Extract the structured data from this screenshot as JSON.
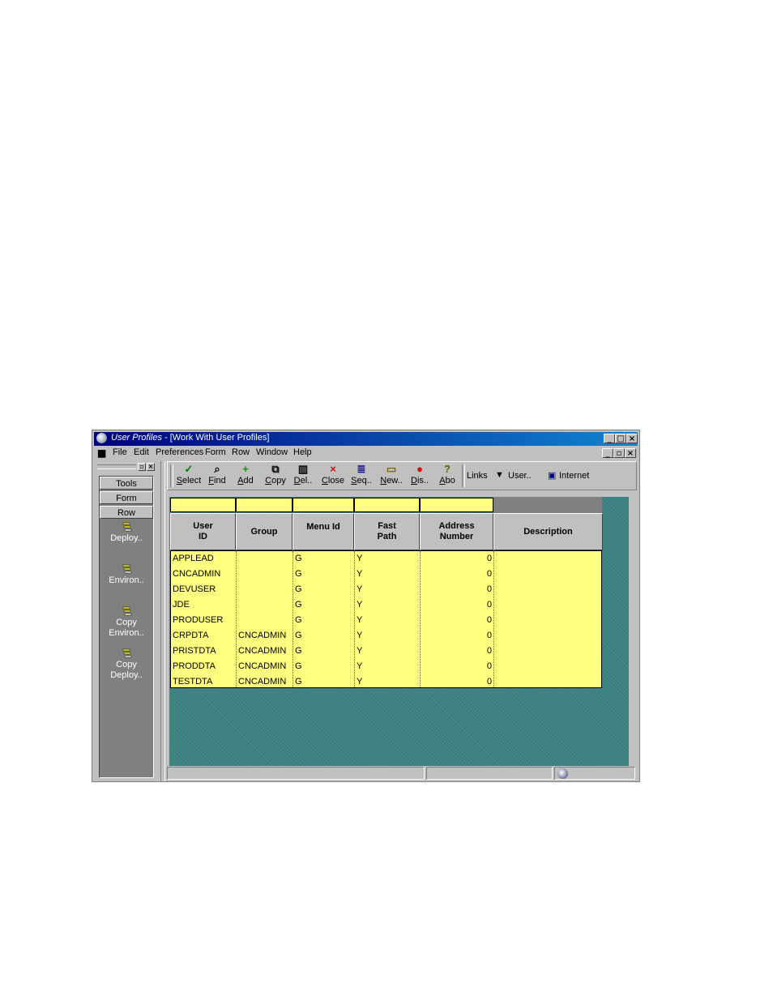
{
  "window": {
    "app_title": "User Profiles",
    "form_title": " - [Work With User Profiles]"
  },
  "menu": [
    "File",
    "Edit",
    "Preferences",
    "Form",
    "Row",
    "Window",
    "Help"
  ],
  "sidebar": {
    "tabs": [
      "Tools",
      "Form",
      "Row"
    ],
    "items": [
      {
        "line1": "Deploy..",
        "line2": ""
      },
      {
        "line1": "Environ..",
        "line2": ""
      },
      {
        "line1": "Copy",
        "line2": "Environ.."
      },
      {
        "line1": "Copy",
        "line2": "Deploy.."
      }
    ]
  },
  "toolbar": {
    "buttons": [
      {
        "label": "Select",
        "icon": "check-icon"
      },
      {
        "label": "Find",
        "icon": "find-icon"
      },
      {
        "label": "Add",
        "icon": "plus-icon"
      },
      {
        "label": "Copy",
        "icon": "copy-icon"
      },
      {
        "label": "Del..",
        "icon": "trash-icon"
      },
      {
        "label": "Close",
        "icon": "x-icon"
      },
      {
        "label": "Seq..",
        "icon": "sequence-icon"
      },
      {
        "label": "New..",
        "icon": "new-icon"
      },
      {
        "label": "Dis..",
        "icon": "display-icon"
      },
      {
        "label": "Abo",
        "icon": "about-icon"
      }
    ],
    "links_label": "Links",
    "user_label": "User..",
    "internet_label": "Internet"
  },
  "grid": {
    "columns": [
      {
        "line1": "User",
        "line2": "ID"
      },
      {
        "line1": "Group",
        "line2": ""
      },
      {
        "line1": "Menu Id",
        "line2": ""
      },
      {
        "line1": "Fast",
        "line2": "Path"
      },
      {
        "line1": "Address",
        "line2": "Number"
      },
      {
        "line1": "Description",
        "line2": ""
      }
    ],
    "rows": [
      [
        "APPLEAD",
        "",
        "G",
        "Y",
        "0",
        ""
      ],
      [
        "CNCADMIN",
        "",
        "G",
        "Y",
        "0",
        ""
      ],
      [
        "DEVUSER",
        "",
        "G",
        "Y",
        "0",
        ""
      ],
      [
        "JDE",
        "",
        "G",
        "Y",
        "0",
        ""
      ],
      [
        "PRODUSER",
        "",
        "G",
        "Y",
        "0",
        ""
      ],
      [
        "CRPDTA",
        "CNCADMIN",
        "G",
        "Y",
        "0",
        ""
      ],
      [
        "PRISTDTA",
        "CNCADMIN",
        "G",
        "Y",
        "0",
        ""
      ],
      [
        "PRODDTA",
        "CNCADMIN",
        "G",
        "Y",
        "0",
        ""
      ],
      [
        "TESTDTA",
        "CNCADMIN",
        "G",
        "Y",
        "0",
        ""
      ]
    ]
  },
  "colors": {
    "grid_background": "#3a7f7f",
    "row_fill": "#ffff80",
    "title_bar": "#000080"
  }
}
